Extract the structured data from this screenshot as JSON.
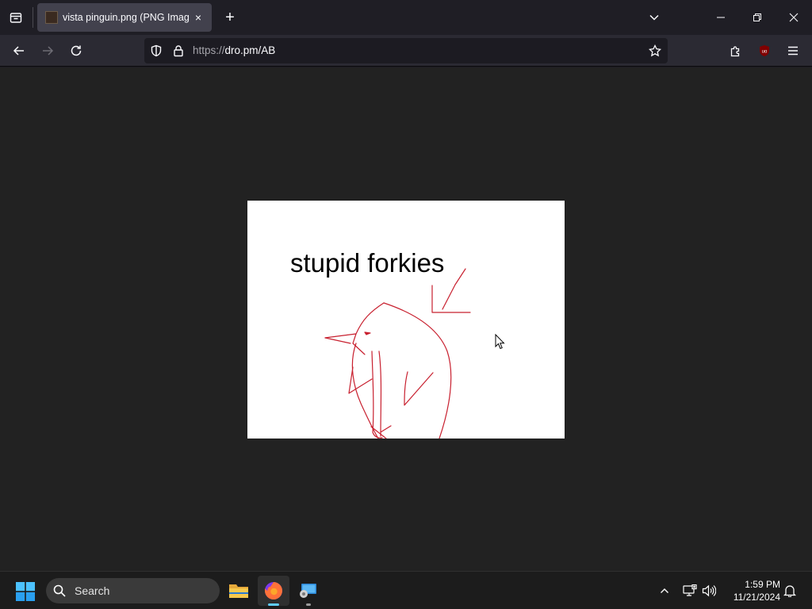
{
  "browser": {
    "tab": {
      "title": "vista pinguin.png (PNG Image,",
      "close_glyph": "×"
    },
    "new_tab_glyph": "+",
    "url": {
      "protocol": "https://",
      "host_path": "dro.pm/AB"
    }
  },
  "image": {
    "caption": "stupid forkies",
    "drawing_color": "#c8202f"
  },
  "taskbar": {
    "search_label": "Search",
    "clock": {
      "time": "1:59 PM",
      "date": "11/21/2024"
    }
  }
}
